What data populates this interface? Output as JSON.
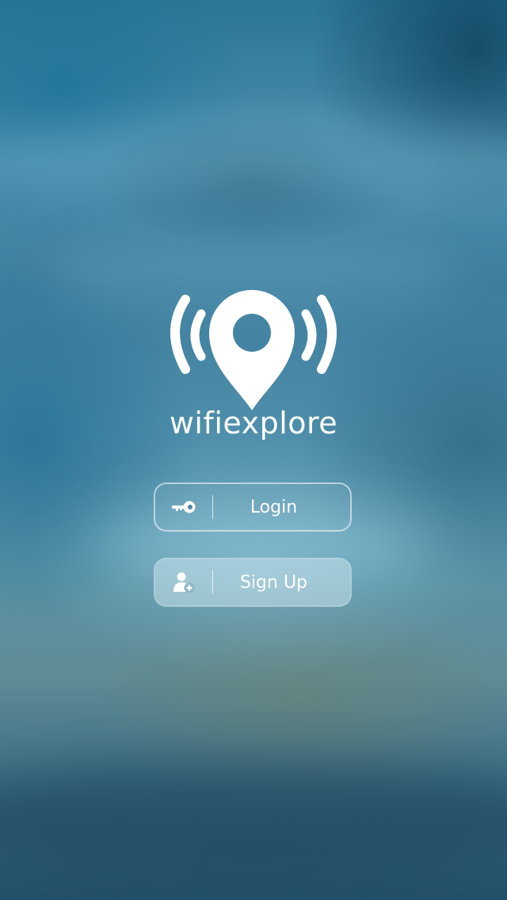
{
  "app": {
    "brand_name": "wifiexplore"
  },
  "buttons": {
    "login_label": "Login",
    "signup_label": "Sign Up"
  },
  "icons": {
    "logo": "wifi-location-pin-icon",
    "login": "key-icon",
    "signup": "add-user-icon"
  },
  "colors": {
    "text": "#ffffff",
    "background": "#2f7590"
  }
}
